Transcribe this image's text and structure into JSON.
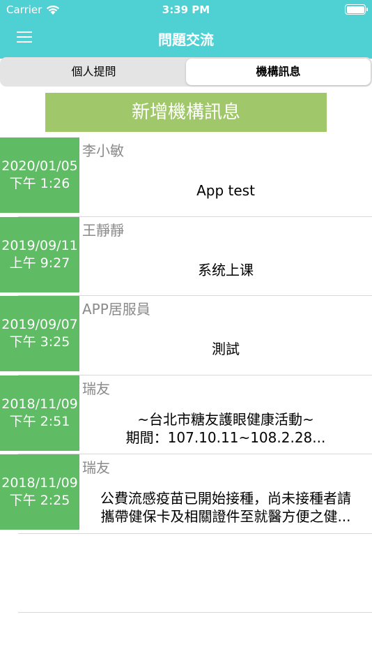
{
  "status_bar": {
    "carrier": "Carrier",
    "time": "3:39 PM",
    "wifi_icon": "wifi-icon",
    "battery_icon": "battery-icon"
  },
  "header": {
    "title": "問題交流",
    "menu_icon": "hamburger-menu-icon",
    "bg_color": "#4fd0d3"
  },
  "tabs": [
    {
      "label": "個人提問",
      "active": false
    },
    {
      "label": "機構訊息",
      "active": true
    }
  ],
  "add_button": {
    "label": "新增機構訊息",
    "color": "#a0c86a"
  },
  "date_block_color": "#5fbb64",
  "messages": [
    {
      "date": "2020/01/05",
      "time": "下午 1:26",
      "author": "李小敏",
      "lines": [
        "App test"
      ]
    },
    {
      "date": "2019/09/11",
      "time": "上午 9:27",
      "author": "王靜靜",
      "lines": [
        "系统上课"
      ]
    },
    {
      "date": "2019/09/07",
      "time": "下午 3:25",
      "author": "APP居服員",
      "lines": [
        "測試"
      ]
    },
    {
      "date": "2018/11/09",
      "time": "下午 2:51",
      "author": "瑞友",
      "lines": [
        "~台北市糖友護眼健康活動~",
        "期間：107.10.11~108.2.28..."
      ]
    },
    {
      "date": "2018/11/09",
      "time": "下午 2:25",
      "author": "瑞友",
      "lines": [
        "公費流感疫苗已開始接種，尚未接種者請",
        "攜帶健保卡及相關證件至就醫方便之健..."
      ]
    }
  ]
}
